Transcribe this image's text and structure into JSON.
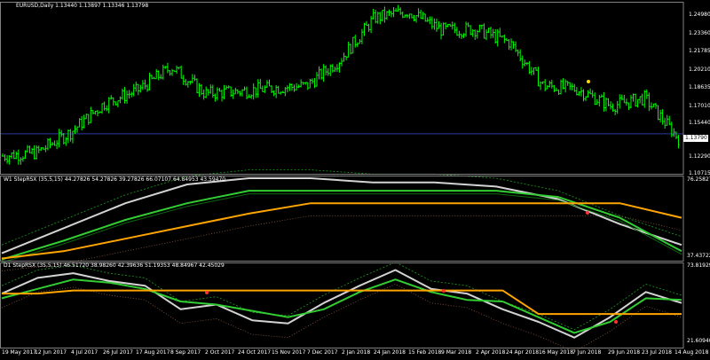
{
  "main_title": "EURUSD,Daily  1.13440 1.13897 1.13346 1.13798",
  "current_price": "1.13790",
  "price_labels": [
    "1.24980",
    "1.23360",
    "1.21785",
    "1.20210",
    "1.18635",
    "1.17010",
    "1.15440",
    "1.12290",
    "1.10715"
  ],
  "w1_title": "W1 StepRSX (35,5,15) 44.27826 54.27826 39.27826 66.07107 64.84953 43.59470",
  "w1_labels": [
    "76.25827",
    "37.43722"
  ],
  "d1_title": "D1 StepRSX (35,5,15) 46.51720 38.98260 42.39636 51.19353 48.84967 42.45029",
  "d1_labels": [
    "73.81929",
    "21.60940"
  ],
  "date_labels": [
    "19 May 2017",
    "12 Jun 2017",
    "4 Jul 2017",
    "26 Jul 2017",
    "17 Aug 2017",
    "8 Sep 2017",
    "2 Oct 2017",
    "24 Oct 2017",
    "15 Nov 2017",
    "7 Dec 2017",
    "2 Jan 2018",
    "24 Jan 2018",
    "15 Feb 2018",
    "9 Mar 2018",
    "2 Apr 2018",
    "24 Apr 2018",
    "16 May 2018",
    "7 Jun 2018",
    "29 Jun 2018",
    "23 Jul 2018",
    "14 Aug 2018"
  ],
  "colors": {
    "background": "#000000",
    "bull_bar": "#00ff00",
    "bear_bar": "#00ff00",
    "grid": "#404040",
    "price_line": "#2a3aa0",
    "rsx_white": "#d3d3d3",
    "rsx_green": "#32cd32",
    "rsx_orange": "#ffa500",
    "rsx_dots_green": "#1e9e1e",
    "rsx_dots_brown": "#8b5a40",
    "marker_red": "#ff3030",
    "marker_gold": "#ffd700"
  },
  "chart_data": {
    "type": "candlestick",
    "symbol": "EURUSD",
    "timeframe": "Daily",
    "ohlc_latest": {
      "open": 1.1344,
      "high": 1.13897,
      "low": 1.13346,
      "close": 1.13798
    },
    "price_range": [
      1.10715,
      1.2565
    ],
    "close_trend": [
      [
        "19 May 2017",
        1.118
      ],
      [
        "12 Jun 2017",
        1.121
      ],
      [
        "4 Jul 2017",
        1.139
      ],
      [
        "26 Jul 2017",
        1.165
      ],
      [
        "17 Aug 2017",
        1.177
      ],
      [
        "8 Sep 2017",
        1.198
      ],
      [
        "2 Oct 2017",
        1.174
      ],
      [
        "24 Oct 2017",
        1.176
      ],
      [
        "15 Nov 2017",
        1.179
      ],
      [
        "7 Dec 2017",
        1.181
      ],
      [
        "2 Jan 2018",
        1.205
      ],
      [
        "24 Jan 2018",
        1.242
      ],
      [
        "15 Feb 2018",
        1.248
      ],
      [
        "9 Mar 2018",
        1.231
      ],
      [
        "2 Apr 2018",
        1.232
      ],
      [
        "24 Apr 2018",
        1.22
      ],
      [
        "16 May 2018",
        1.181
      ],
      [
        "7 Jun 2018",
        1.178
      ],
      [
        "29 Jun 2018",
        1.163
      ],
      [
        "23 Jul 2018",
        1.17
      ],
      [
        "14 Aug 2018",
        1.134
      ]
    ],
    "w1_range": [
      37.43722,
      76.25827
    ],
    "w1_series": {
      "white": [
        40,
        52,
        64,
        73,
        76,
        76,
        74,
        74,
        72,
        66,
        54,
        44
      ],
      "green": [
        37,
        46,
        56,
        64,
        70,
        70,
        70,
        70,
        70,
        67,
        57,
        41
      ],
      "orange": [
        37.5,
        41,
        47,
        53,
        59,
        64,
        64,
        64,
        64,
        64,
        64,
        57
      ]
    },
    "d1_range": [
      21.6094,
      73.81929
    ],
    "d1_series": {
      "white": [
        55,
        65,
        68,
        63,
        60,
        45,
        48,
        38,
        36,
        49,
        60,
        70,
        58,
        55,
        45,
        37,
        27,
        40,
        56,
        49
      ],
      "green": [
        52,
        58,
        64,
        62,
        58,
        50,
        48,
        44,
        40,
        45,
        56,
        64,
        56,
        51,
        50,
        40,
        30,
        37,
        52,
        51
      ],
      "orange": [
        55,
        55,
        57,
        57,
        57,
        57,
        57,
        57,
        57,
        57,
        57,
        57,
        57,
        57,
        57,
        42,
        42,
        42,
        42,
        42
      ]
    }
  }
}
